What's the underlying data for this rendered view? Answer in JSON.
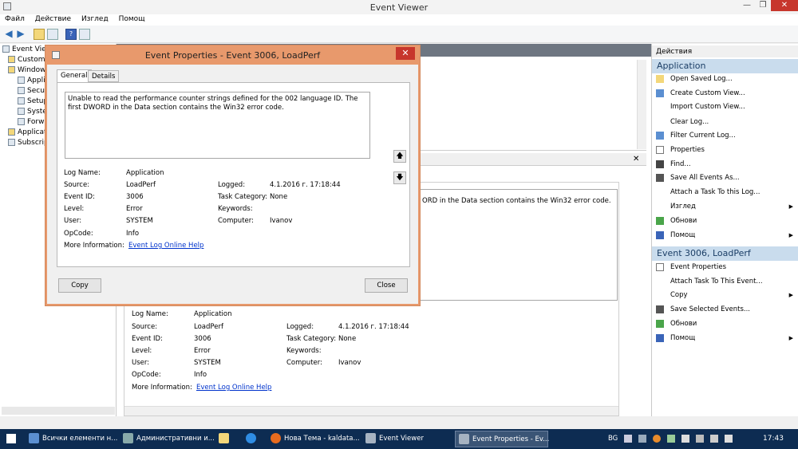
{
  "window": {
    "title": "Event Viewer",
    "min": "—",
    "max": "❐",
    "close": "✕"
  },
  "menu": [
    "Файл",
    "Действие",
    "Изглед",
    "Помощ"
  ],
  "tree": [
    "Event Viewer",
    "Custom V",
    "Windows",
    "Appli",
    "Secur",
    "Setup",
    "Syste",
    "Forw",
    "Applicatio",
    "Subscript"
  ],
  "actions": {
    "header": "Действия",
    "section1": "Application",
    "items1": [
      "Open Saved Log...",
      "Create Custom View...",
      "Import Custom View...",
      "Clear Log...",
      "Filter Current Log...",
      "Properties",
      "Find...",
      "Save All Events As...",
      "Attach a Task To this Log...",
      "Изглед",
      "Обнови",
      "Помощ"
    ],
    "section2": "Event 3006, LoadPerf",
    "items2": [
      "Event Properties",
      "Attach Task To This Event...",
      "Copy",
      "Save Selected Events...",
      "Обнови",
      "Помощ"
    ]
  },
  "preview": {
    "msg_fragment": "ORD in the Data section contains the Win32 error code.",
    "close": "✕",
    "fields": {
      "log_name_label": "Log Name:",
      "log_name": "Application",
      "source_label": "Source:",
      "source": "LoadPerf",
      "logged_label": "Logged:",
      "logged": "4.1.2016 г. 17:18:44",
      "event_id_label": "Event ID:",
      "event_id": "3006",
      "task_cat_label": "Task Category:",
      "task_cat": "None",
      "level_label": "Level:",
      "level": "Error",
      "keywords_label": "Keywords:",
      "user_label": "User:",
      "user": "SYSTEM",
      "computer_label": "Computer:",
      "computer": "Ivanov",
      "opcode_label": "OpCode:",
      "opcode": "Info",
      "more_info_label": "More Information:",
      "more_info": "Event Log Online Help"
    }
  },
  "dialog": {
    "title": "Event Properties - Event 3006, LoadPerf",
    "close": "✕",
    "tabs": [
      "General",
      "Details"
    ],
    "message": "Unable to read the performance counter strings defined for the 002 language ID. The first DWORD in the Data section contains the Win32 error code.",
    "up": "🡅",
    "down": "🡇",
    "copy": "Copy",
    "close_btn": "Close"
  },
  "taskbar": {
    "items": [
      "Всички елементи н...",
      "Административни и...",
      "",
      "",
      "Нова Тема - kaldata...",
      "Event Viewer",
      "Event Properties - Ev..."
    ],
    "lang": "BG",
    "time": "17:43"
  },
  "colors": {
    "dialog_frame": "#e8996c",
    "section_bg": "#c9dced",
    "taskbar": "#0d2c52"
  }
}
